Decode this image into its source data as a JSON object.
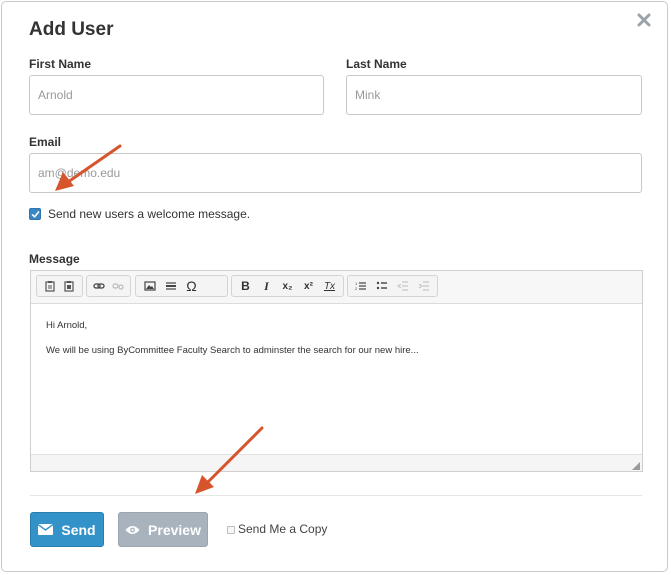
{
  "modal": {
    "title": "Add User",
    "close_icon": "close-icon"
  },
  "form": {
    "first_name": {
      "label": "First Name",
      "value": "Arnold"
    },
    "last_name": {
      "label": "Last Name",
      "value": "Mink"
    },
    "email": {
      "label": "Email",
      "value": "am@demo.edu"
    },
    "welcome": {
      "label": "Send new users a welcome message.",
      "checked": true
    },
    "message_label": "Message"
  },
  "editor": {
    "toolbar_groups": [
      [
        "paste-icon",
        "paste-text-icon"
      ],
      [
        "link-icon",
        "unlink-icon"
      ],
      [
        "image-icon",
        "horizontal-rule-icon",
        "special-char-icon"
      ],
      [
        "bold-icon",
        "italic-icon",
        "subscript-icon",
        "superscript-icon",
        "remove-format-icon"
      ],
      [
        "numbered-list-icon",
        "bulleted-list-icon",
        "decrease-indent-icon",
        "increase-indent-icon"
      ]
    ],
    "glyphs": {
      "special_char": "Ω",
      "bold": "B",
      "italic": "I",
      "subscript": "x₂",
      "superscript": "x²",
      "remove_format": "Tx"
    },
    "line1": "Hi Arnold,",
    "line2": "We will be using ByCommittee Faculty Search to adminster the search for our new hire..."
  },
  "actions": {
    "send_label": "Send",
    "preview_label": "Preview",
    "copy_label": "Send Me a Copy",
    "copy_checked": false
  },
  "colors": {
    "send": "#3393c9",
    "preview": "#a8b3bd",
    "checkbox": "#3a87c6",
    "arrow": "#d6552c"
  }
}
